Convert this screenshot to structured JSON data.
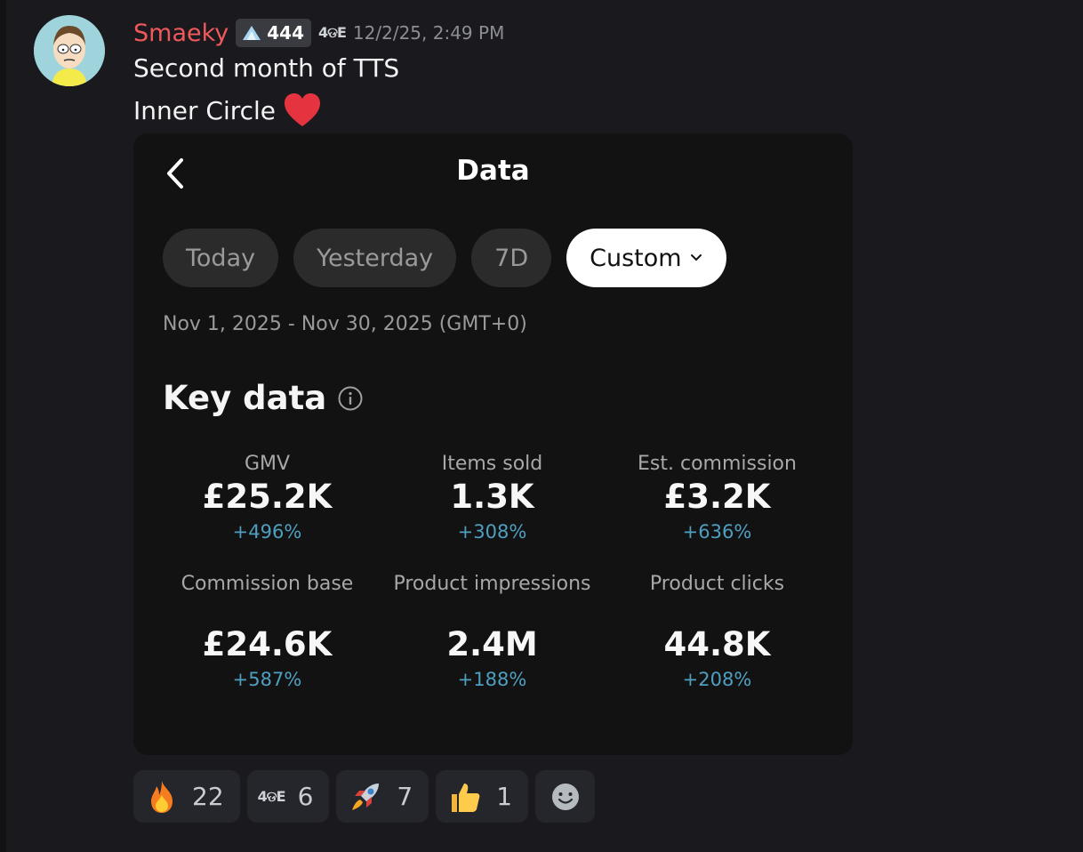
{
  "message": {
    "username": "Smaeky",
    "tag_count": "444",
    "server_tag": "4ଡE",
    "timestamp": "12/2/25, 2:49 PM",
    "line1": "Second month of TTS",
    "line2": "Inner Circle"
  },
  "card": {
    "title": "Data",
    "tabs": [
      "Today",
      "Yesterday",
      "7D",
      "Custom"
    ],
    "active_tab": "Custom",
    "date_range": "Nov 1, 2025 - Nov 30, 2025 (GMT+0)",
    "section_title": "Key data",
    "metrics": [
      {
        "label": "GMV",
        "value": "£25.2K",
        "change": "+496%"
      },
      {
        "label": "Items sold",
        "value": "1.3K",
        "change": "+308%"
      },
      {
        "label": "Est. commission",
        "value": "£3.2K",
        "change": "+636%"
      },
      {
        "label": "Commission base",
        "value": "£24.6K",
        "change": "+587%"
      },
      {
        "label": "Product impressions",
        "value": "2.4M",
        "change": "+188%"
      },
      {
        "label": "Product clicks",
        "value": "44.8K",
        "change": "+208%"
      }
    ]
  },
  "reactions": [
    {
      "icon": "fire-emoji",
      "count": "22"
    },
    {
      "icon": "server-emoji",
      "label": "4ଡE",
      "count": "6"
    },
    {
      "icon": "rocket-emoji",
      "count": "7"
    },
    {
      "icon": "thumbs-up-emoji",
      "count": "1"
    }
  ],
  "colors": {
    "username": "#f0595c",
    "change_positive": "#4f9fc0",
    "background": "#1a1a1e"
  }
}
